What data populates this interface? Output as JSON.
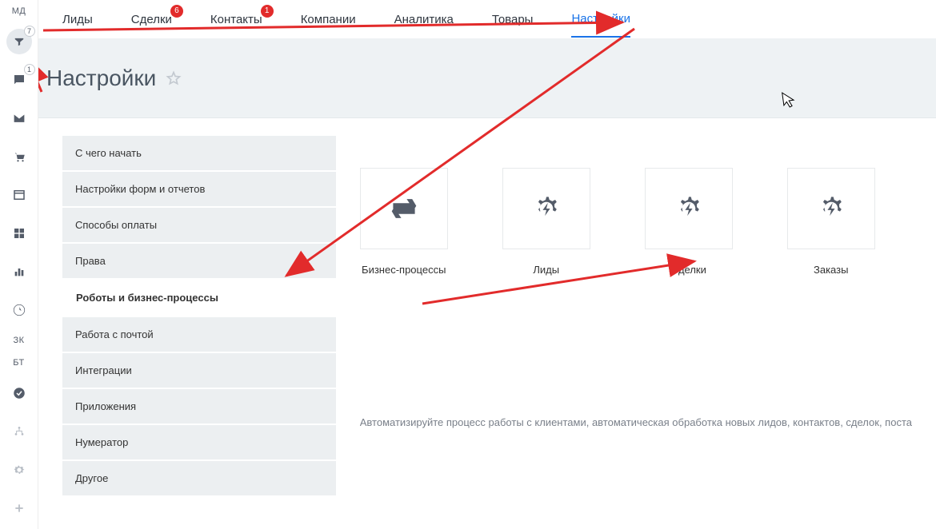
{
  "rail": {
    "initials1": "МД",
    "funnel_badge": "7",
    "chat_badge": "1",
    "initials2": "ЗК",
    "initials3": "БТ"
  },
  "tabs": {
    "leads": {
      "label": "Лиды"
    },
    "deals": {
      "label": "Сделки",
      "badge": "6"
    },
    "contacts": {
      "label": "Контакты",
      "badge": "1"
    },
    "companies": {
      "label": "Компании"
    },
    "analytics": {
      "label": "Аналитика"
    },
    "goods": {
      "label": "Товары"
    },
    "settings": {
      "label": "Настройки"
    }
  },
  "page": {
    "title": "Настройки"
  },
  "settings_menu": [
    "С чего начать",
    "Настройки форм и отчетов",
    "Способы оплаты",
    "Права",
    "Роботы и бизнес-процессы",
    "Работа с почтой",
    "Интеграции",
    "Приложения",
    "Нумератор",
    "Другое"
  ],
  "settings_menu_active_index": 4,
  "tiles": [
    {
      "label": "Бизнес-процессы",
      "icon": "cycle"
    },
    {
      "label": "Лиды",
      "icon": "gearbolt"
    },
    {
      "label": "Сделки",
      "icon": "gearbolt"
    },
    {
      "label": "Заказы",
      "icon": "gearbolt"
    }
  ],
  "hint": "Автоматизируйте процесс работы с клиентами, автоматическая обработка новых лидов, контактов, сделок, поста"
}
